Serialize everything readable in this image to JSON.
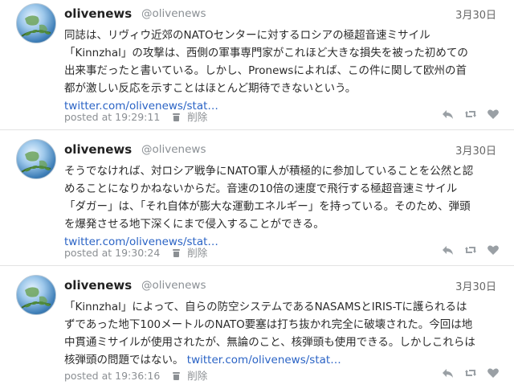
{
  "tweets": [
    {
      "name": "olivenews",
      "handle": "@olivenews",
      "date": "3月30日",
      "lines": [
        "同誌は、リヴィウ近郊のNATOセンターに対するロシアの極超音速ミサイル",
        "「Kinnzhal」の攻撃は、西側の軍事専門家がこれほど大きな損失を被った初めての",
        "出来事だったと書いている。しかし、Pronewsによれば、この件に関して欧州の首",
        "都が激しい反応を示すことはほとんど期待できないという。"
      ],
      "link": "twitter.com/olivenews/stat…",
      "posted_at": "posted at 19:29:11",
      "delete_label": "削除"
    },
    {
      "name": "olivenews",
      "handle": "@olivenews",
      "date": "3月30日",
      "lines": [
        "そうでなければ、対ロシア戦争にNATO軍人が積極的に参加していることを公然と認",
        "めることになりかねないからだ。音速の10倍の速度で飛行する極超音速ミサイル",
        "「ダガー」は、「それ自体が膨大な運動エネルギー」を持っている。そのため、弾頭",
        "を爆発させる地下深くにまで侵入することができる。"
      ],
      "link": "twitter.com/olivenews/stat…",
      "posted_at": "posted at 19:30:24",
      "delete_label": "削除"
    },
    {
      "name": "olivenews",
      "handle": "@olivenews",
      "date": "3月30日",
      "lines": [
        "「Kinnzhal」によって、自らの防空システムであるNASAMSとIRIS-Tに護られるは",
        "ずであった地下100メートルのNATO要塞は打ち抜かれ完全に破壊された。今回は地",
        "中貫通ミサイルが使用されたが、無論のこと、核弾頭も使用できる。しかしこれらは"
      ],
      "last_line_prefix": "核弾頭の問題ではない。 ",
      "link": "twitter.com/olivenews/stat…",
      "posted_at": "posted at 19:36:16",
      "delete_label": "削除"
    }
  ],
  "icons": {
    "avatar": "globe-olive-branch-avatar",
    "reply": "reply-icon",
    "retweet": "retweet-icon",
    "favorite": "heart-icon",
    "delete": "trash-icon"
  },
  "colors": {
    "link": "#2a63c5",
    "meta": "#8b8f93",
    "divider": "#e3e3e3"
  }
}
